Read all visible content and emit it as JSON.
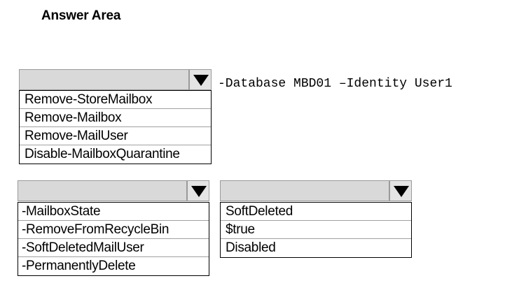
{
  "title": "Answer Area",
  "command_suffix": "-Database MBD01 –Identity User1",
  "dropdown_cmdlet": {
    "selected": "",
    "options": [
      "Remove-StoreMailbox",
      "Remove-Mailbox",
      "Remove-MailUser",
      "Disable-MailboxQuarantine"
    ]
  },
  "dropdown_parameter": {
    "selected": "",
    "options": [
      "-MailboxState",
      "-RemoveFromRecycleBin",
      "-SoftDeletedMailUser",
      "-PermanentlyDelete"
    ]
  },
  "dropdown_value": {
    "selected": "",
    "options": [
      "SoftDeleted",
      "$true",
      "Disabled"
    ]
  },
  "icons": {
    "arrow": "triangle-down-icon"
  }
}
